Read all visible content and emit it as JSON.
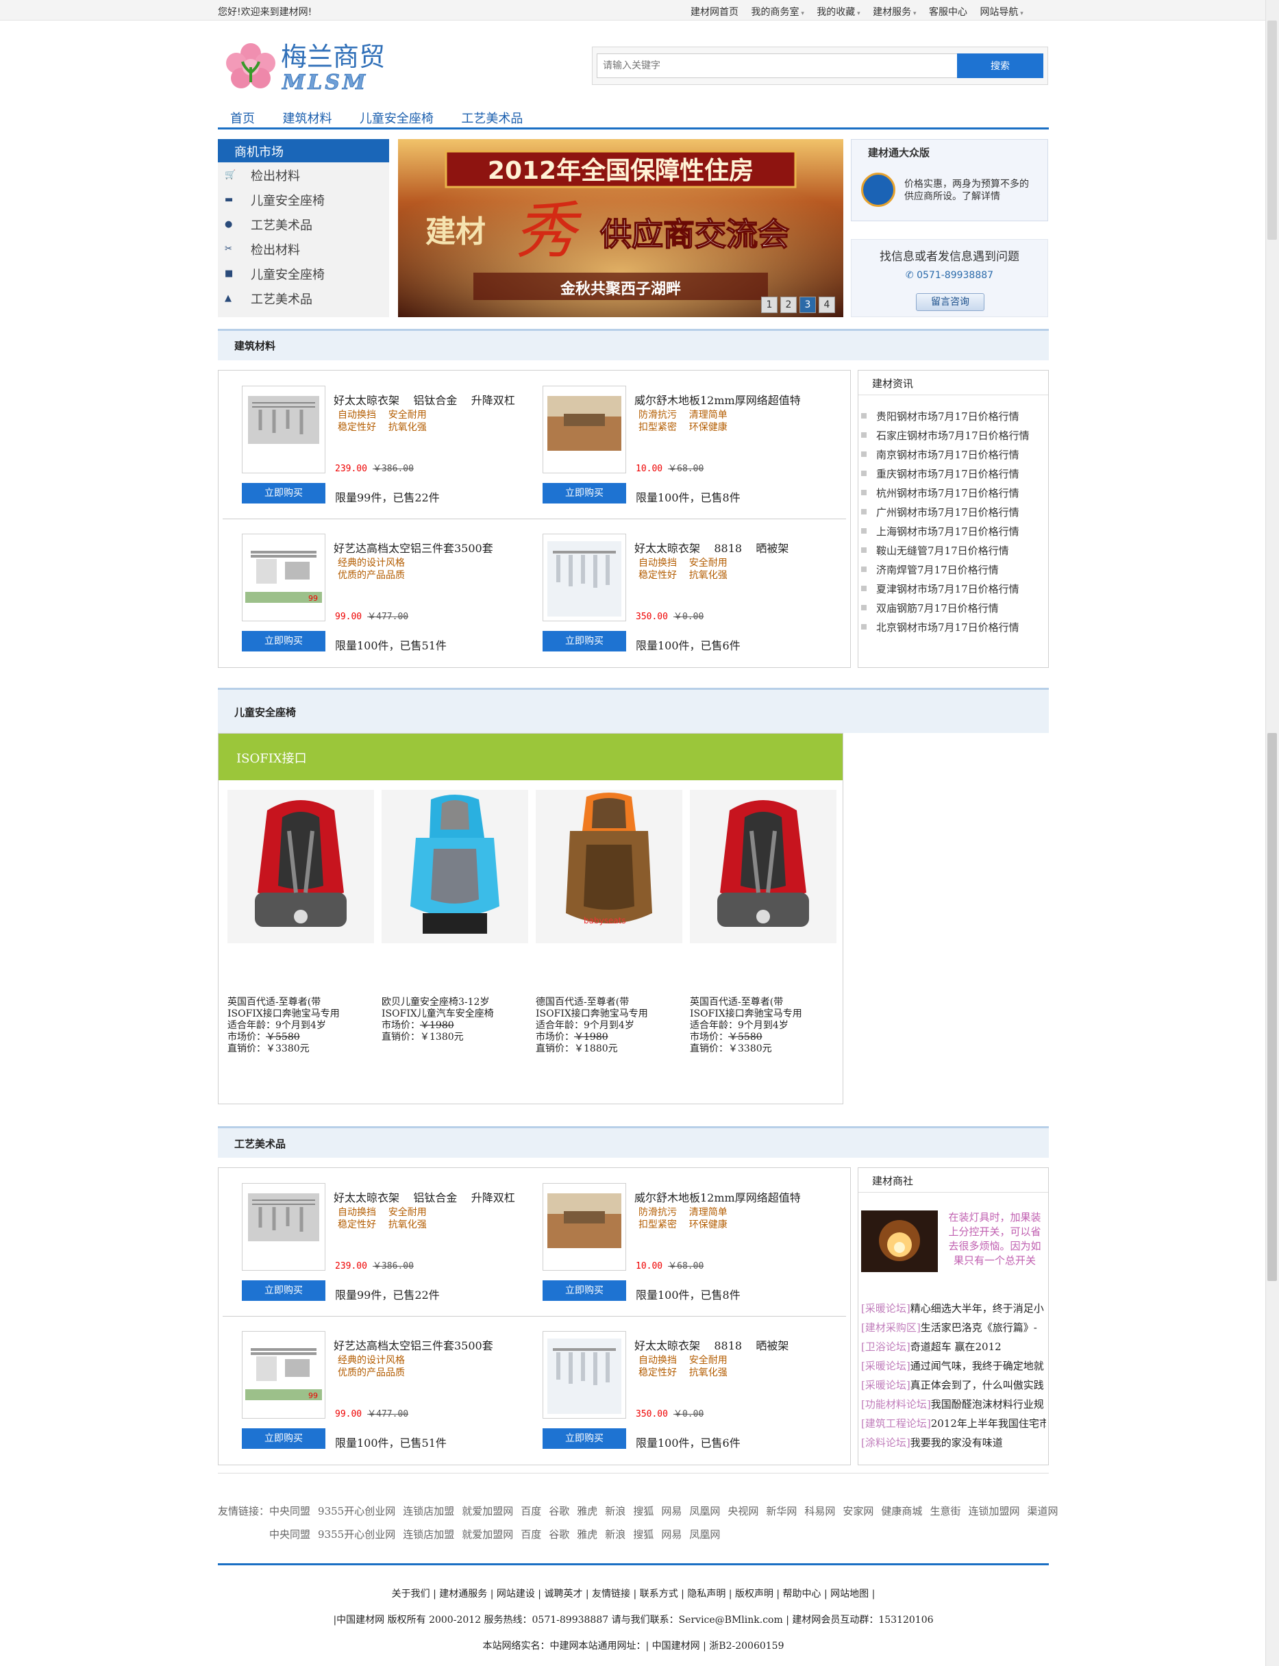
{
  "topbar": {
    "welcome": "您好!欢迎来到建材网!",
    "links": [
      "建材网首页",
      "我的商务室",
      "我的收藏",
      "建材服务",
      "客服中心",
      "网站导航"
    ]
  },
  "logo": {
    "name": "梅兰商贸",
    "abbr": "MLSM"
  },
  "search": {
    "placeholder": "请输入关键字",
    "button": "搜索"
  },
  "nav": [
    "首页",
    "建筑材料",
    "儿童安全座椅",
    "工艺美术品"
  ],
  "category": {
    "title": "商机市场",
    "items": [
      "检出材料",
      "儿童安全座椅",
      "工艺美术品",
      "检出材料",
      "儿童安全座椅",
      "工艺美术品"
    ]
  },
  "banner": {
    "headline": "2012年全国保障性住房",
    "sub1": "建材",
    "sub2": "供应商交流会",
    "tagline": "金秋共聚西子湖畔",
    "pages": [
      "1",
      "2",
      "3",
      "4"
    ],
    "active_page": "3"
  },
  "edition": {
    "title": "建材通大众版",
    "text": "价格实惠，两身为预算不多的供应商所设。了解详情"
  },
  "contact": {
    "question": "找信息或者发信息遇到问题",
    "phone": "0571-89938887",
    "button": "留言咨询"
  },
  "section1": {
    "title": "建筑材料",
    "products": [
      {
        "name": "好太太晾衣架    铝钛合金    升降双杠",
        "tags": "自动换挡    安全耐用\n稳定性好    抗氧化强",
        "price": "239.00",
        "old": "￥386.00",
        "buy": "立即购买",
        "stock": "限量99件，已售22件"
      },
      {
        "name": "威尔舒木地板12mm厚网络超值特",
        "tags": "防滑抗污    清理简单\n扣型紧密    环保健康",
        "price": "10.00",
        "old": "￥68.00",
        "buy": "立即购买",
        "stock": "限量100件，已售8件"
      },
      {
        "name": "好艺达高档太空铝三件套3500套",
        "tags": "经典的设计风格\n优质的产品品质",
        "price": "99.00",
        "old": "￥477.00",
        "buy": "立即购买",
        "stock": "限量100件，已售51件"
      },
      {
        "name": "好太太晾衣架    8818    晒被架",
        "tags": "自动换挡    安全耐用\n稳定性好    抗氧化强",
        "price": "350.00",
        "old": "￥0.00",
        "buy": "立即购买",
        "stock": "限量100件，已售6件"
      }
    ],
    "news_title": "建材资讯",
    "news": [
      "贵阳钢材市场7月17日价格行情",
      "石家庄钢材市场7月17日价格行情",
      "南京钢材市场7月17日价格行情",
      "重庆钢材市场7月17日价格行情",
      "杭州钢材市场7月17日价格行情",
      "广州钢材市场7月17日价格行情",
      "上海钢材市场7月17日价格行情",
      "鞍山无缝管7月17日价格行情",
      "济南焊管7月17日价格行情",
      "夏津钢材市场7月17日价格行情",
      "双庙钢筋7月17日价格行情",
      "北京钢材市场7月17日价格行情"
    ]
  },
  "section2": {
    "title": "儿童安全座椅",
    "bar": "ISOFIX接口",
    "seats": [
      {
        "l1": "英国百代适-至尊者(带",
        "l2": "ISOFIX接口奔驰宝马专用",
        "l3": "适合年龄：9个月到4岁",
        "l4a": "市场价：",
        "l4b": "￥5580",
        "l5": "直销价：￥3380元"
      },
      {
        "l1": "欧贝儿童安全座椅3-12岁",
        "l2": "ISOFIX儿童汽车安全座椅",
        "l3": "",
        "l4a": "市场价：",
        "l4b": "￥1980",
        "l5": "直销价：￥1380元"
      },
      {
        "l1": "德国百代适-至尊者(带",
        "l2": "ISOFIX接口奔驰宝马专用",
        "l3": "适合年龄：9个月到4岁",
        "l4a": "市场价：",
        "l4b": "￥1980",
        "l5": "直销价：￥1880元"
      },
      {
        "l1": "英国百代适-至尊者(带",
        "l2": "ISOFIX接口奔驰宝马专用",
        "l3": "适合年龄：9个月到4岁",
        "l4a": "市场价：",
        "l4b": "￥5580",
        "l5": "直销价：￥3380元"
      }
    ]
  },
  "section3": {
    "title": "工艺美术品",
    "products": [
      {
        "name": "好太太晾衣架    铝钛合金    升降双杠",
        "tags": "自动换挡    安全耐用\n稳定性好    抗氧化强",
        "price": "239.00",
        "old": "￥386.00",
        "buy": "立即购买",
        "stock": "限量99件，已售22件"
      },
      {
        "name": "威尔舒木地板12mm厚网络超值特",
        "tags": "防滑抗污    清理简单\n扣型紧密    环保健康",
        "price": "10.00",
        "old": "￥68.00",
        "buy": "立即购买",
        "stock": "限量100件，已售8件"
      },
      {
        "name": "好艺达高档太空铝三件套3500套",
        "tags": "经典的设计风格\n优质的产品品质",
        "price": "99.00",
        "old": "￥477.00",
        "buy": "立即购买",
        "stock": "限量100件，已售51件"
      },
      {
        "name": "好太太晾衣架    8818    晒被架",
        "tags": "自动换挡    安全耐用\n稳定性好    抗氧化强",
        "price": "350.00",
        "old": "￥0.00",
        "buy": "立即购买",
        "stock": "限量100件，已售6件"
      }
    ],
    "sj_title": "建材商社",
    "sj_lead": "在装灯具时，加果装上分控开关，可以省去很多烦恼。因为如果只有一个总开关",
    "sj_items": [
      {
        "cat": "[采暖论坛]",
        "text": "精心细选大半年，终于消足小"
      },
      {
        "cat": "[建材采购区]",
        "text": "生活家巴洛克《旅行篇》-"
      },
      {
        "cat": "[卫浴论坛]",
        "text": "奇道超车 赢在2012"
      },
      {
        "cat": "[采暖论坛]",
        "text": "通过闻气味，我终于确定地就"
      },
      {
        "cat": "[采暖论坛]",
        "text": "真正体会到了，什么叫傲实践"
      },
      {
        "cat": "[功能材料论坛]",
        "text": "我国酚醛泡沫材料行业规"
      },
      {
        "cat": "[建筑工程论坛]",
        "text": "2012年上半年我国住宅市"
      },
      {
        "cat": "[涂料论坛]",
        "text": "我要我的家没有味道"
      }
    ]
  },
  "friends": {
    "label": "友情链接：",
    "row1": [
      "中央同盟",
      "9355开心创业网",
      "连锁店加盟",
      "就爱加盟网",
      "百度",
      "谷歌",
      "雅虎",
      "新浪",
      "搜狐",
      "网易",
      "凤凰网",
      "央视网",
      "新华网",
      "科易网",
      "安家网",
      "健康商城",
      "生意街",
      "连锁加盟网",
      "渠道网"
    ],
    "row2": [
      "中央同盟",
      "9355开心创业网",
      "连锁店加盟",
      "就爱加盟网",
      "百度",
      "谷歌",
      "雅虎",
      "新浪",
      "搜狐",
      "网易",
      "凤凰网"
    ]
  },
  "footer": {
    "links": "关于我们 | 建材通服务 | 网站建设 | 诚聘英才 | 友情链接 | 联系方式 | 隐私声明 | 版权声明 | 帮助中心 | 网站地图 |",
    "copyright": "|中国建材网 版权所有 2000-2012 服务热线：0571-89938887 请与我们联系：Service@BMlink.com | 建材网会员互动群：153120106",
    "icp": "本站网络实名：中建网本站通用网址：| 中国建材网 | 浙B2-20060159"
  },
  "colors": {
    "brand_blue": "#1a6fc4",
    "button_blue": "#1e73d2",
    "green_bar": "#9bc63a",
    "price_red": "#e00000",
    "tag_orange": "#b35c00"
  }
}
